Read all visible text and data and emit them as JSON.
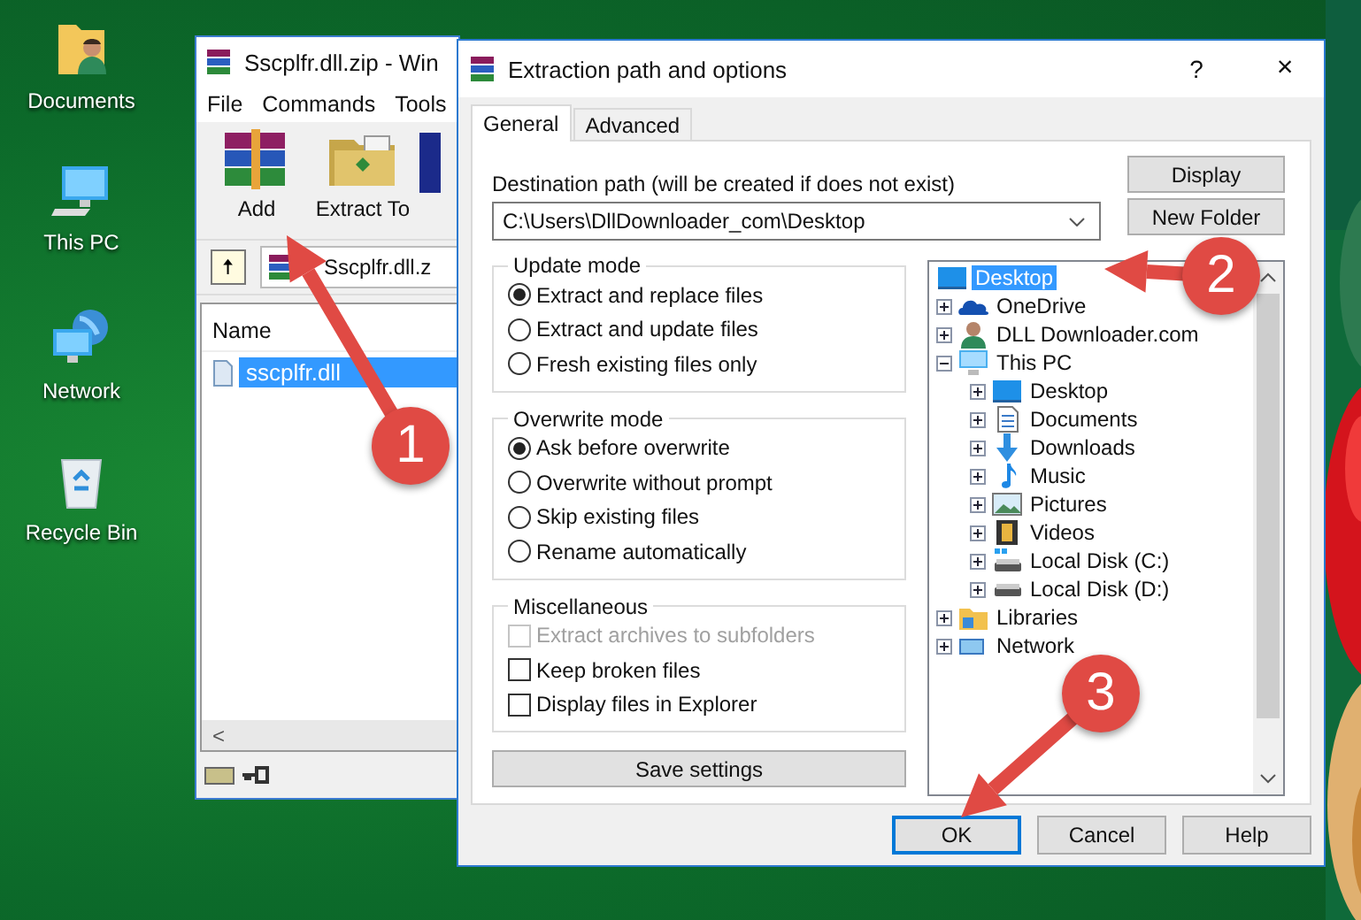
{
  "desktop_icons": [
    {
      "label": "Documents",
      "kind": "user-folder"
    },
    {
      "label": "This PC",
      "kind": "computer"
    },
    {
      "label": "Network",
      "kind": "network"
    },
    {
      "label": "Recycle Bin",
      "kind": "recycle"
    }
  ],
  "archive_window": {
    "title": "Sscplfr.dll.zip - Win",
    "menu": [
      "File",
      "Commands",
      "Tools"
    ],
    "toolbar": [
      {
        "label": "Add",
        "kind": "add"
      },
      {
        "label": "Extract To",
        "kind": "extract"
      }
    ],
    "up_button": "🠅",
    "address": "Sscplfr.dll.z",
    "column": "Name",
    "files": [
      {
        "name": "sscplfr.dll",
        "selected": true
      }
    ],
    "scroll_left": "<"
  },
  "dialog": {
    "title": "Extraction path and options",
    "help": "?",
    "close": "×",
    "tabs": [
      {
        "label": "General",
        "selected": true
      },
      {
        "label": "Advanced",
        "selected": false
      }
    ],
    "destination_label": "Destination path (will be created if does not exist)",
    "destination_path": "C:\\Users\\DllDownloader_com\\Desktop",
    "side_buttons": [
      "Display",
      "New Folder"
    ],
    "groups": [
      {
        "title": "Update mode",
        "options": [
          {
            "kind": "radio",
            "label": "Extract and replace files",
            "checked": true,
            "disabled": false
          },
          {
            "kind": "radio",
            "label": "Extract and update files",
            "checked": false,
            "disabled": false
          },
          {
            "kind": "radio",
            "label": "Fresh existing files only",
            "checked": false,
            "disabled": false
          }
        ]
      },
      {
        "title": "Overwrite mode",
        "options": [
          {
            "kind": "radio",
            "label": "Ask before overwrite",
            "checked": true,
            "disabled": false
          },
          {
            "kind": "radio",
            "label": "Overwrite without prompt",
            "checked": false,
            "disabled": false
          },
          {
            "kind": "radio",
            "label": "Skip existing files",
            "checked": false,
            "disabled": false
          },
          {
            "kind": "radio",
            "label": "Rename automatically",
            "checked": false,
            "disabled": false
          }
        ]
      },
      {
        "title": "Miscellaneous",
        "options": [
          {
            "kind": "checkbox",
            "label": "Extract archives to subfolders",
            "checked": false,
            "disabled": true
          },
          {
            "kind": "checkbox",
            "label": "Keep broken files",
            "checked": false,
            "disabled": false
          },
          {
            "kind": "checkbox",
            "label": "Display files in Explorer",
            "checked": false,
            "disabled": false
          }
        ]
      }
    ],
    "save_button": "Save settings",
    "tree": [
      {
        "label": "Desktop",
        "kind": "monitor",
        "selected": true,
        "children": [
          {
            "label": "OneDrive",
            "kind": "cloud",
            "selected": false,
            "expanded": false
          },
          {
            "label": "DLL Downloader.com",
            "kind": "person",
            "selected": false,
            "expanded": false
          },
          {
            "label": "This PC",
            "kind": "computer",
            "selected": false,
            "expanded": true,
            "children": [
              {
                "label": "Desktop",
                "kind": "monitor",
                "selected": false,
                "expanded": false
              },
              {
                "label": "Documents",
                "kind": "document",
                "selected": false,
                "expanded": false
              },
              {
                "label": "Downloads",
                "kind": "download",
                "selected": false,
                "expanded": false
              },
              {
                "label": "Music",
                "kind": "music",
                "selected": false,
                "expanded": false
              },
              {
                "label": "Pictures",
                "kind": "pictures",
                "selected": false,
                "expanded": false
              },
              {
                "label": "Videos",
                "kind": "video",
                "selected": false,
                "expanded": false
              },
              {
                "label": "Local Disk (C:)",
                "kind": "system-drive",
                "selected": false,
                "expanded": false
              },
              {
                "label": "Local Disk (D:)",
                "kind": "drive",
                "selected": false,
                "expanded": false
              }
            ]
          },
          {
            "label": "Libraries",
            "kind": "folder",
            "selected": false,
            "expanded": false
          },
          {
            "label": "Network",
            "kind": "network",
            "selected": false,
            "expanded": false
          }
        ]
      }
    ],
    "buttons": [
      {
        "label": "OK",
        "default": true
      },
      {
        "label": "Cancel",
        "default": false
      },
      {
        "label": "Help",
        "default": false
      }
    ]
  },
  "annotations": [
    {
      "number": "1"
    },
    {
      "number": "2"
    },
    {
      "number": "3"
    }
  ]
}
